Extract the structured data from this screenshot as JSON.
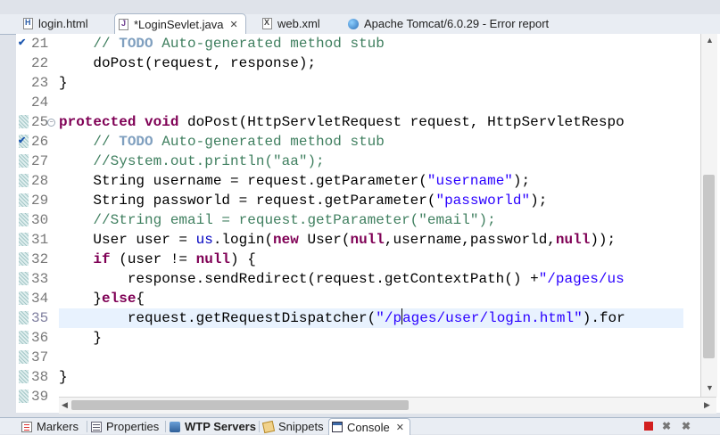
{
  "editor_tabs": [
    {
      "label": "login.html",
      "icon": "html-file-icon",
      "active": false
    },
    {
      "label": "*LoginSevlet.java",
      "icon": "java-file-icon",
      "active": true,
      "closable": true
    },
    {
      "label": "web.xml",
      "icon": "xml-file-icon",
      "active": false
    },
    {
      "label": "Apache Tomcat/6.0.29 - Error report",
      "icon": "globe-icon",
      "active": false
    }
  ],
  "close_glyph": "✕",
  "line_numbers": [
    "21",
    "22",
    "23",
    "24",
    "25",
    "26",
    "27",
    "28",
    "29",
    "30",
    "31",
    "32",
    "33",
    "34",
    "35",
    "36",
    "37",
    "38",
    "39"
  ],
  "current_line": "35",
  "code_lines": [
    [
      {
        "t": "    "
      },
      {
        "t": "// ",
        "c": "comment"
      },
      {
        "t": "TODO",
        "c": "todo"
      },
      {
        "t": " Auto-generated method stub",
        "c": "comment"
      }
    ],
    [
      {
        "t": "    doPost(request, response);"
      }
    ],
    [
      {
        "t": "}"
      }
    ],
    [
      {
        "t": ""
      }
    ],
    [
      {
        "t": "protected",
        "c": "kw"
      },
      {
        "t": " "
      },
      {
        "t": "void",
        "c": "kw"
      },
      {
        "t": " doPost(HttpServletRequest request, HttpServletRespo"
      }
    ],
    [
      {
        "t": "    "
      },
      {
        "t": "// ",
        "c": "comment"
      },
      {
        "t": "TODO",
        "c": "todo"
      },
      {
        "t": " Auto-generated method stub",
        "c": "comment"
      }
    ],
    [
      {
        "t": "    "
      },
      {
        "t": "//System.out.println(\"aa\");",
        "c": "comment"
      }
    ],
    [
      {
        "t": "    String username = request.getParameter("
      },
      {
        "t": "\"username\"",
        "c": "string"
      },
      {
        "t": ");"
      }
    ],
    [
      {
        "t": "    String passworld = request.getParameter("
      },
      {
        "t": "\"passworld\"",
        "c": "string"
      },
      {
        "t": ");"
      }
    ],
    [
      {
        "t": "    "
      },
      {
        "t": "//String email = request.getParameter(\"email\");",
        "c": "comment"
      }
    ],
    [
      {
        "t": "    User user = "
      },
      {
        "t": "us",
        "c": "field"
      },
      {
        "t": ".login("
      },
      {
        "t": "new",
        "c": "kw"
      },
      {
        "t": " User("
      },
      {
        "t": "null",
        "c": "kw"
      },
      {
        "t": ",username,passworld,"
      },
      {
        "t": "null",
        "c": "kw"
      },
      {
        "t": "));"
      }
    ],
    [
      {
        "t": "    "
      },
      {
        "t": "if",
        "c": "kw"
      },
      {
        "t": " (user != "
      },
      {
        "t": "null",
        "c": "kw"
      },
      {
        "t": ") {"
      }
    ],
    [
      {
        "t": "        response.sendRedirect(request.getContextPath() +"
      },
      {
        "t": "\"/pages/us",
        "c": "string"
      }
    ],
    [
      {
        "t": "    }"
      },
      {
        "t": "else",
        "c": "kw"
      },
      {
        "t": "{"
      }
    ],
    [
      {
        "t": "        request.getRequestDispatcher("
      },
      {
        "t": "\"/p",
        "c": "string"
      },
      {
        "caret": true
      },
      {
        "t": "ages/user/login.html\"",
        "c": "string"
      },
      {
        "t": ").for"
      }
    ],
    [
      {
        "t": "    }"
      }
    ],
    [
      {
        "t": ""
      }
    ],
    [
      {
        "t": "}"
      }
    ],
    [
      {
        "t": ""
      }
    ]
  ],
  "ruler": {
    "override_markers": [
      "21",
      "26"
    ],
    "fold_marker": "25",
    "hatched_lines": [
      "25",
      "26",
      "27",
      "28",
      "29",
      "30",
      "31",
      "32",
      "33",
      "34",
      "35",
      "36",
      "37",
      "38",
      "39"
    ]
  },
  "view_tabs": [
    {
      "label": "Markers",
      "icon": "markers-icon",
      "active": false
    },
    {
      "label": "Properties",
      "icon": "properties-icon",
      "active": false
    },
    {
      "label": "WTP Servers",
      "icon": "server-icon",
      "active": false,
      "bold": true
    },
    {
      "label": "Snippets",
      "icon": "snippets-icon",
      "active": false
    },
    {
      "label": "Console",
      "icon": "console-icon",
      "active": true,
      "closable": true
    }
  ],
  "view_toolbar": [
    "terminate-icon",
    "remove-launch-icon",
    "remove-all-icon"
  ]
}
